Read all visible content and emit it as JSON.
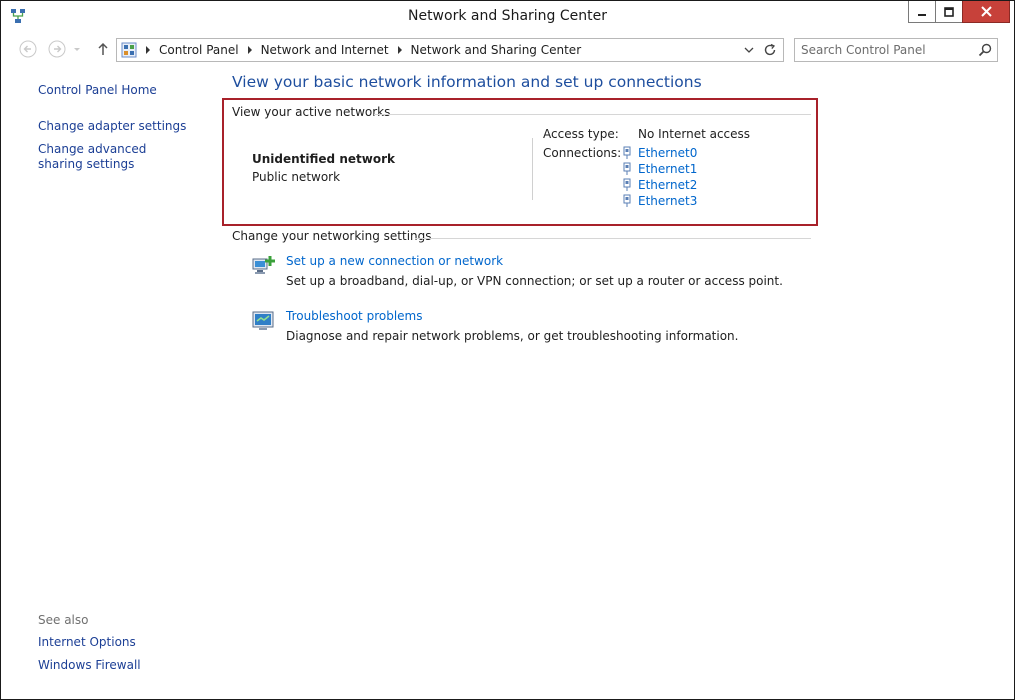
{
  "window": {
    "title": "Network and Sharing Center"
  },
  "nav": {
    "breadcrumbs": [
      "Control Panel",
      "Network and Internet",
      "Network and Sharing Center"
    ],
    "search_placeholder": "Search Control Panel"
  },
  "sidebar": {
    "items": [
      "Control Panel Home",
      "Change adapter settings",
      "Change advanced sharing settings"
    ],
    "see_also_label": "See also",
    "see_also_items": [
      "Internet Options",
      "Windows Firewall"
    ]
  },
  "main": {
    "heading": "View your basic network information and set up connections",
    "active_networks_label": "View your active networks",
    "network": {
      "name": "Unidentified network",
      "type": "Public network",
      "access_type_label": "Access type:",
      "access_type_value": "No Internet access",
      "connections_label": "Connections:",
      "connections": [
        "Ethernet0",
        "Ethernet1",
        "Ethernet2",
        "Ethernet3"
      ]
    },
    "settings_label": "Change your networking settings",
    "tasks": [
      {
        "title": "Set up a new connection or network",
        "description": "Set up a broadband, dial-up, or VPN connection; or set up a router or access point."
      },
      {
        "title": "Troubleshoot problems",
        "description": "Diagnose and repair network problems, or get troubleshooting information."
      }
    ]
  },
  "colors": {
    "link": "#0066cc",
    "heading": "#1e4e9e",
    "highlight_border": "#a8212a",
    "close_button": "#c7413a"
  }
}
